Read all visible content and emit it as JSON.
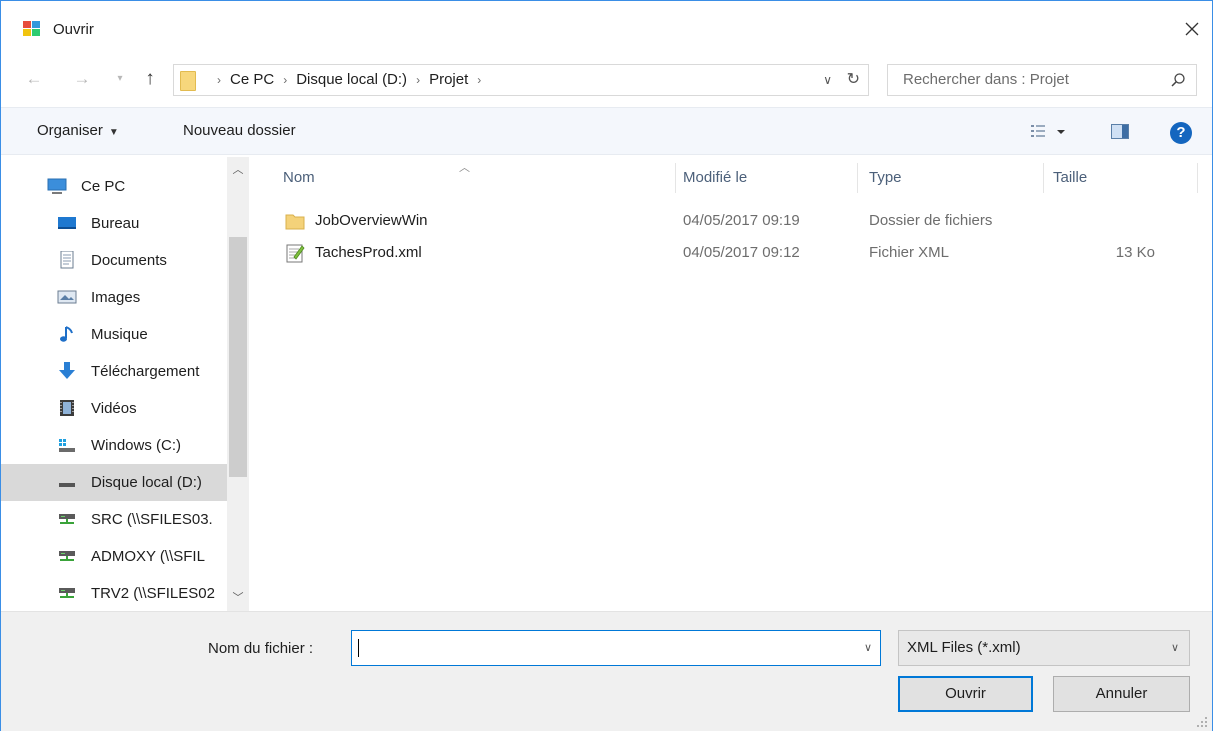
{
  "window": {
    "title": "Ouvrir"
  },
  "nav": {
    "breadcrumbs": [
      "Ce PC",
      "Disque local (D:)",
      "Projet"
    ],
    "search_placeholder": "Rechercher dans : Projet"
  },
  "toolbar": {
    "organise_label": "Organiser",
    "new_folder_label": "Nouveau dossier"
  },
  "sidebar": {
    "items": [
      {
        "label": "Ce PC",
        "icon": "computer-icon"
      },
      {
        "label": "Bureau",
        "icon": "desktop-icon"
      },
      {
        "label": "Documents",
        "icon": "documents-icon"
      },
      {
        "label": "Images",
        "icon": "images-icon"
      },
      {
        "label": "Musique",
        "icon": "music-icon"
      },
      {
        "label": "Téléchargement",
        "icon": "download-icon"
      },
      {
        "label": "Vidéos",
        "icon": "videos-icon"
      },
      {
        "label": "Windows (C:)",
        "icon": "windows-drive-icon"
      },
      {
        "label": "Disque local (D:)",
        "icon": "drive-icon"
      },
      {
        "label": "SRC (\\\\SFILES03.",
        "icon": "network-drive-icon"
      },
      {
        "label": "ADMOXY (\\\\SFIL",
        "icon": "network-drive-icon"
      },
      {
        "label": "TRV2 (\\\\SFILES02",
        "icon": "network-drive-icon"
      }
    ],
    "selected_index": 8
  },
  "columns": {
    "name": "Nom",
    "modified": "Modifié le",
    "type": "Type",
    "size": "Taille"
  },
  "files": [
    {
      "name": "JobOverviewWin",
      "modified": "04/05/2017 09:19",
      "type": "Dossier de fichiers",
      "size": "",
      "icon": "folder-icon"
    },
    {
      "name": "TachesProd.xml",
      "modified": "04/05/2017 09:12",
      "type": "Fichier XML",
      "size": "13 Ko",
      "icon": "xml-file-icon"
    }
  ],
  "footer": {
    "filename_label": "Nom du fichier :",
    "filename_value": "",
    "filter_value": "XML Files (*.xml)",
    "open_label": "Ouvrir",
    "cancel_label": "Annuler"
  },
  "colors": {
    "accent": "#0078d7",
    "toolbar_bg": "#f4f7fc",
    "selected_bg": "#d9d9d9",
    "footer_bg": "#f0f0f0"
  }
}
